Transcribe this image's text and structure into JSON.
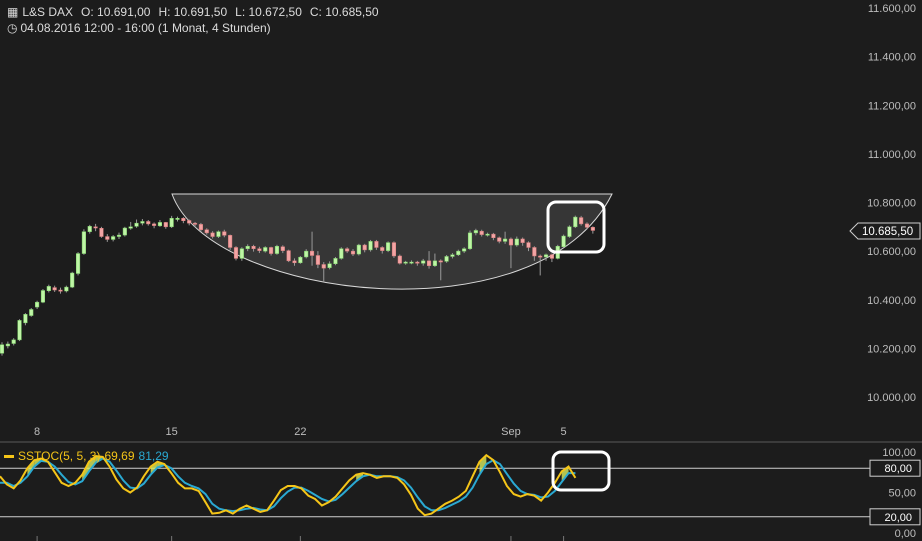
{
  "header": {
    "instrument": "L&S DAX",
    "open": "O: 10.691,00",
    "high": "H: 10.691,50",
    "low": "L: 10.672,50",
    "close": "C: 10.685,50",
    "period": "04.08.2016 12:00 - 16:00 (1 Monat, 4 Stunden)"
  },
  "chart_data": [
    {
      "type": "candlestick",
      "title": "L&S DAX",
      "y_ticks": [
        "11.600,00",
        "11.400,00",
        "11.200,00",
        "11.000,00",
        "10.800,00",
        "10.600,00",
        "10.400,00",
        "10.200,00",
        "10.000,00"
      ],
      "y_tick_values": [
        11600,
        11400,
        11200,
        11000,
        10800,
        10600,
        10400,
        10200,
        10000
      ],
      "ylim": [
        9900,
        11650
      ],
      "x_ticks": [
        "8",
        "15",
        "22",
        "Sep",
        "5"
      ],
      "x_tick_index": [
        6,
        29,
        51,
        87,
        96
      ],
      "last_price_label": "10.685,50",
      "last_price": 10685.5,
      "up_color": "#bff5a6",
      "down_color": "#f2a4a4",
      "candles": [
        [
          10180,
          10215,
          10170,
          10225
        ],
        [
          10210,
          10218,
          10200,
          10228
        ],
        [
          10220,
          10235,
          10212,
          10242
        ],
        [
          10235,
          10315,
          10230,
          10320
        ],
        [
          10305,
          10340,
          10295,
          10345
        ],
        [
          10335,
          10360,
          10330,
          10366
        ],
        [
          10370,
          10390,
          10362,
          10396
        ],
        [
          10390,
          10438,
          10386,
          10444
        ],
        [
          10437,
          10455,
          10430,
          10462
        ],
        [
          10450,
          10440,
          10432,
          10458
        ],
        [
          10440,
          10436,
          10425,
          10450
        ],
        [
          10436,
          10452,
          10430,
          10458
        ],
        [
          10452,
          10510,
          10448,
          10515
        ],
        [
          10508,
          10590,
          10500,
          10596
        ],
        [
          10590,
          10680,
          10585,
          10690
        ],
        [
          10680,
          10702,
          10672,
          10708
        ],
        [
          10700,
          10695,
          10682,
          10712
        ],
        [
          10694,
          10660,
          10655,
          10700
        ],
        [
          10660,
          10648,
          10638,
          10670
        ],
        [
          10648,
          10660,
          10640,
          10666
        ],
        [
          10660,
          10666,
          10650,
          10676
        ],
        [
          10666,
          10695,
          10660,
          10700
        ],
        [
          10694,
          10700,
          10688,
          10720
        ],
        [
          10702,
          10715,
          10696,
          10730
        ],
        [
          10715,
          10722,
          10706,
          10732
        ],
        [
          10722,
          10712,
          10705,
          10728
        ],
        [
          10712,
          10705,
          10694,
          10718
        ],
        [
          10704,
          10718,
          10700,
          10728
        ],
        [
          10718,
          10700,
          10692,
          10720
        ],
        [
          10700,
          10735,
          10695,
          10745
        ],
        [
          10735,
          10735,
          10722,
          10742
        ],
        [
          10735,
          10725,
          10715,
          10740
        ],
        [
          10726,
          10715,
          10706,
          10730
        ],
        [
          10715,
          10710,
          10698,
          10720
        ],
        [
          10710,
          10688,
          10680,
          10716
        ],
        [
          10688,
          10675,
          10668,
          10694
        ],
        [
          10675,
          10660,
          10652,
          10682
        ],
        [
          10660,
          10680,
          10654,
          10685
        ],
        [
          10680,
          10665,
          10657,
          10688
        ],
        [
          10665,
          10615,
          10605,
          10668
        ],
        [
          10615,
          10570,
          10562,
          10620
        ],
        [
          10570,
          10610,
          10560,
          10616
        ],
        [
          10610,
          10620,
          10600,
          10628
        ],
        [
          10620,
          10610,
          10598,
          10626
        ],
        [
          10610,
          10602,
          10592,
          10618
        ],
        [
          10600,
          10615,
          10594,
          10620
        ],
        [
          10615,
          10590,
          10582,
          10618
        ],
        [
          10590,
          10620,
          10585,
          10626
        ],
        [
          10618,
          10602,
          10592,
          10624
        ],
        [
          10602,
          10560,
          10555,
          10606
        ],
        [
          10560,
          10552,
          10540,
          10570
        ],
        [
          10552,
          10575,
          10548,
          10580
        ],
        [
          10576,
          10600,
          10570,
          10608
        ],
        [
          10600,
          10582,
          10540,
          10680
        ],
        [
          10582,
          10545,
          10530,
          10600
        ],
        [
          10545,
          10530,
          10470,
          10555
        ],
        [
          10532,
          10548,
          10525,
          10558
        ],
        [
          10548,
          10570,
          10542,
          10576
        ],
        [
          10570,
          10610,
          10565,
          10616
        ],
        [
          10610,
          10600,
          10592,
          10616
        ],
        [
          10600,
          10588,
          10580,
          10608
        ],
        [
          10588,
          10625,
          10582,
          10630
        ],
        [
          10625,
          10605,
          10595,
          10630
        ],
        [
          10605,
          10640,
          10598,
          10646
        ],
        [
          10640,
          10615,
          10605,
          10646
        ],
        [
          10615,
          10602,
          10590,
          10620
        ],
        [
          10602,
          10635,
          10596,
          10640
        ],
        [
          10635,
          10580,
          10572,
          10640
        ],
        [
          10580,
          10550,
          10545,
          10586
        ],
        [
          10550,
          10555,
          10544,
          10560
        ],
        [
          10555,
          10555,
          10546,
          10562
        ],
        [
          10555,
          10550,
          10540,
          10560
        ],
        [
          10550,
          10560,
          10540,
          10568
        ],
        [
          10560,
          10540,
          10528,
          10600
        ],
        [
          10540,
          10560,
          10535,
          10590
        ],
        [
          10560,
          10558,
          10480,
          10566
        ],
        [
          10558,
          10578,
          10552,
          10584
        ],
        [
          10578,
          10585,
          10570,
          10592
        ],
        [
          10585,
          10600,
          10580,
          10606
        ],
        [
          10600,
          10610,
          10592,
          10616
        ],
        [
          10610,
          10675,
          10605,
          10685
        ],
        [
          10675,
          10685,
          10665,
          10692
        ],
        [
          10682,
          10668,
          10660,
          10688
        ],
        [
          10668,
          10670,
          10660,
          10676
        ],
        [
          10670,
          10655,
          10645,
          10675
        ],
        [
          10655,
          10640,
          10632,
          10660
        ],
        [
          10640,
          10650,
          10630,
          10680
        ],
        [
          10650,
          10625,
          10530,
          10656
        ],
        [
          10625,
          10650,
          10618,
          10660
        ],
        [
          10650,
          10635,
          10622,
          10656
        ],
        [
          10635,
          10615,
          10600,
          10640
        ],
        [
          10615,
          10580,
          10560,
          10620
        ],
        [
          10580,
          10575,
          10500,
          10586
        ],
        [
          10576,
          10585,
          10560,
          10590
        ],
        [
          10585,
          10570,
          10555,
          10590
        ],
        [
          10570,
          10620,
          10566,
          10626
        ],
        [
          10618,
          10662,
          10614,
          10668
        ],
        [
          10660,
          10700,
          10655,
          10706
        ],
        [
          10700,
          10740,
          10695,
          10746
        ],
        [
          10738,
          10712,
          10705,
          10745
        ],
        [
          10712,
          10698,
          10690,
          10718
        ],
        [
          10698,
          10685,
          10672,
          10702
        ]
      ]
    },
    {
      "type": "line",
      "title": "SSTOC(5, 5, 3)",
      "series": [
        {
          "name": "SSTOC(5, 5, 3)",
          "label": "69,69",
          "color": "#f5c518",
          "values": [
            70,
            60,
            55,
            65,
            80,
            90,
            92,
            88,
            75,
            62,
            58,
            62,
            72,
            88,
            95,
            94,
            82,
            66,
            55,
            50,
            56,
            70,
            82,
            88,
            85,
            74,
            62,
            55,
            55,
            52,
            38,
            24,
            25,
            28,
            24,
            30,
            34,
            30,
            26,
            28,
            40,
            53,
            58,
            58,
            55,
            46,
            42,
            34,
            38,
            45,
            55,
            65,
            72,
            74,
            72,
            68,
            70,
            70,
            68,
            60,
            47,
            30,
            22,
            24,
            30,
            36,
            40,
            45,
            52,
            70,
            88,
            96,
            90,
            75,
            58,
            48,
            45,
            48,
            46,
            40,
            50,
            62,
            76,
            82,
            68
          ]
        },
        {
          "name": "SSTOC(5, 5, 3)",
          "label": "81,29",
          "color": "#2aa9d2",
          "values": [
            62,
            62,
            58,
            62,
            70,
            82,
            89,
            88,
            82,
            72,
            63,
            60,
            64,
            76,
            87,
            92,
            88,
            77,
            65,
            56,
            55,
            61,
            72,
            81,
            84,
            80,
            70,
            62,
            58,
            55,
            48,
            36,
            30,
            28,
            27,
            28,
            30,
            31,
            29,
            28,
            33,
            43,
            51,
            56,
            56,
            52,
            47,
            42,
            39,
            41,
            48,
            56,
            64,
            70,
            72,
            70,
            70,
            70,
            69,
            65,
            56,
            44,
            33,
            28,
            28,
            31,
            35,
            39,
            45,
            56,
            72,
            85,
            90,
            85,
            73,
            61,
            52,
            48,
            47,
            44,
            45,
            52,
            63,
            74,
            74
          ]
        },
        {
          "name": "SSTOC(5, 5, 3)",
          "label": "",
          "color": "#f5c518",
          "values": []
        }
      ],
      "ylim": [
        0,
        100
      ],
      "y_ticks": [
        "100,00",
        "50,00",
        "0,00"
      ],
      "level_labels": [
        "80,00",
        "20,00"
      ],
      "levels": [
        80,
        20
      ],
      "highlight_fill": "#d9ec5f"
    }
  ]
}
